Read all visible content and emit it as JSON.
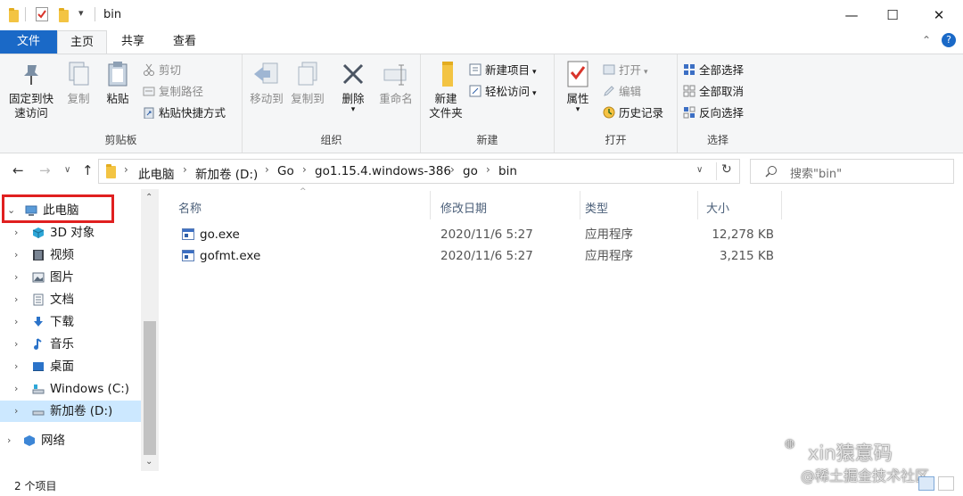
{
  "window": {
    "title": "bin",
    "controls": {
      "minimize": "—",
      "maximize": "☐",
      "close": "✕"
    }
  },
  "ribbon_tabs": [
    "文件",
    "主页",
    "共享",
    "查看"
  ],
  "ribbon": {
    "clipboard": {
      "label": "剪贴板",
      "pin": "固定到快\n速访问",
      "copy": "复制",
      "paste": "粘贴",
      "cut": "剪切",
      "copy_path": "复制路径",
      "paste_shortcut": "粘贴快捷方式"
    },
    "organize": {
      "label": "组织",
      "move_to": "移动到",
      "copy_to": "复制到",
      "delete": "删除",
      "rename": "重命名"
    },
    "new": {
      "label": "新建",
      "new_folder": "新建\n文件夹",
      "new_item": "新建项目",
      "easy_access": "轻松访问"
    },
    "open": {
      "label": "打开",
      "properties": "属性",
      "open": "打开",
      "edit": "编辑",
      "history": "历史记录"
    },
    "select": {
      "label": "选择",
      "select_all": "全部选择",
      "select_none": "全部取消",
      "invert": "反向选择"
    }
  },
  "address": {
    "crumbs": [
      "此电脑",
      "新加卷 (D:)",
      "Go",
      "go1.15.4.windows-386",
      "go",
      "bin"
    ],
    "search_placeholder": "搜索\"bin\""
  },
  "nav_pane": {
    "items": [
      {
        "label": "此电脑",
        "icon": "pc-icon"
      },
      {
        "label": "3D 对象",
        "icon": "3d-objects-icon"
      },
      {
        "label": "视频",
        "icon": "video-icon"
      },
      {
        "label": "图片",
        "icon": "pictures-icon"
      },
      {
        "label": "文档",
        "icon": "documents-icon"
      },
      {
        "label": "下载",
        "icon": "downloads-icon"
      },
      {
        "label": "音乐",
        "icon": "music-icon"
      },
      {
        "label": "桌面",
        "icon": "desktop-icon"
      },
      {
        "label": "Windows (C:)",
        "icon": "drive-c-icon"
      },
      {
        "label": "新加卷 (D:)",
        "icon": "drive-d-icon"
      },
      {
        "label": "网络",
        "icon": "network-icon"
      }
    ]
  },
  "columns": [
    "名称",
    "修改日期",
    "类型",
    "大小"
  ],
  "files": [
    {
      "name": "go.exe",
      "modified": "2020/11/6 5:27",
      "type": "应用程序",
      "size": "12,278 KB"
    },
    {
      "name": "gofmt.exe",
      "modified": "2020/11/6 5:27",
      "type": "应用程序",
      "size": "3,215 KB"
    }
  ],
  "status": {
    "count": "2 个项目"
  },
  "watermark": {
    "line1": "xin猿意码",
    "line2": "@稀土掘金技术社区"
  },
  "colors": {
    "file_tab": "#1a69c7",
    "highlight_box": "#e02020",
    "selected_nav": "#cce8ff"
  }
}
